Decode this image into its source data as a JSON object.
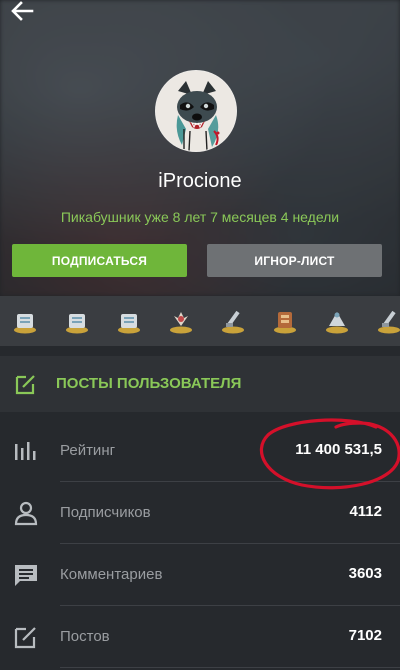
{
  "header": {
    "back_icon": "arrow-left-icon",
    "username": "iProcione",
    "member_since": "Пикабушник уже 8 лет 7 месяцев 4 недели"
  },
  "buttons": {
    "subscribe_label": "ПОДПИСАТЬСЯ",
    "ignore_label": "ИГНОР-ЛИСТ"
  },
  "awards": {
    "icons": [
      "award-icon",
      "award-icon",
      "award-icon",
      "award-icon",
      "award-icon",
      "award-icon",
      "award-icon",
      "award-icon"
    ]
  },
  "posts_link": {
    "icon": "edit-square-icon",
    "label": "ПОСТЫ ПОЛЬЗОВАТЕЛЯ"
  },
  "stats": [
    {
      "icon": "bar-chart-icon",
      "label": "Рейтинг",
      "value": "11 400 531,5"
    },
    {
      "icon": "user-icon",
      "label": "Подписчиков",
      "value": "4112"
    },
    {
      "icon": "comment-icon",
      "label": "Комментариев",
      "value": "3603"
    },
    {
      "icon": "edit-square-icon",
      "label": "Постов",
      "value": "7102"
    }
  ],
  "colors": {
    "accent_green": "#6fb63a",
    "text_green": "#8ac858",
    "background": "#26292d",
    "annotation_red": "#d4102a"
  }
}
